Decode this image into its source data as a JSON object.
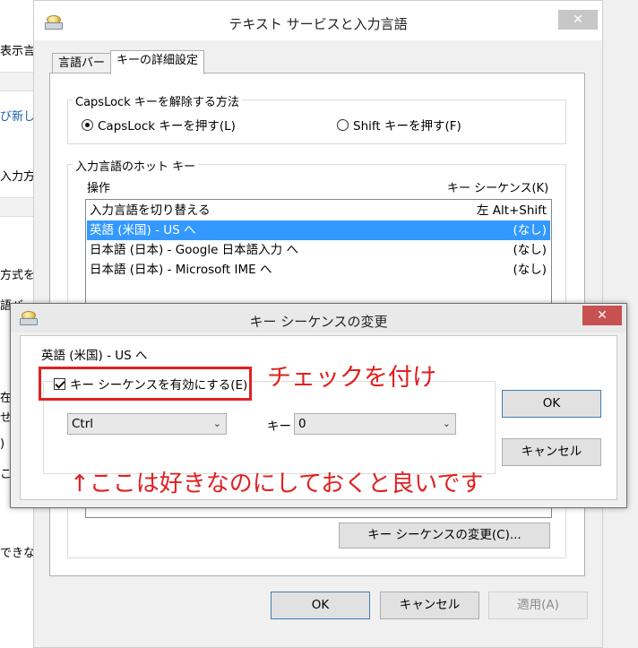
{
  "background_window": {
    "fragments": [
      "表示言",
      "び新し",
      "入力方",
      "方式を記",
      "語バ",
      "在",
      "せ",
      ")",
      "こ",
      "できな"
    ]
  },
  "main_dialog": {
    "title": "テキスト サービスと入力言語",
    "close_glyph": "✕",
    "tabs": [
      {
        "label": "言語バー",
        "active": false
      },
      {
        "label": "キーの詳細設定",
        "active": true
      }
    ],
    "capslock_group": {
      "title": "CapsLock キーを解除する方法",
      "options": [
        {
          "label": "CapsLock キーを押す(L)",
          "selected": true
        },
        {
          "label": "Shift キーを押す(F)",
          "selected": false
        }
      ]
    },
    "hotkey_group": {
      "title": "入力言語のホット キー",
      "col_action": "操作",
      "col_sequence": "キー シーケンス(K)",
      "rows": [
        {
          "action": "入力言語を切り替える",
          "sequence": "左 Alt+Shift",
          "selected": false
        },
        {
          "action": "英語 (米国) - US へ",
          "sequence": "(なし)",
          "selected": true
        },
        {
          "action": "日本語 (日本) - Google 日本語入力 へ",
          "sequence": "(なし)",
          "selected": false
        },
        {
          "action": "日本語 (日本) - Microsoft IME へ",
          "sequence": "(なし)",
          "selected": false
        }
      ],
      "change_button": "キー シーケンスの変更(C)..."
    },
    "ok_button": "OK",
    "cancel_button": "キャンセル",
    "apply_button": "適用(A)"
  },
  "sub_dialog": {
    "title": "キー シーケンスの変更",
    "close_glyph": "✕",
    "language": "英語 (米国) - US へ",
    "enable_checkbox": {
      "label": "キー シーケンスを有効にする(E)",
      "checked": true
    },
    "modifier_select": "Ctrl",
    "key_label": "キー",
    "key_select": "0",
    "ok_button": "OK",
    "cancel_button": "キャンセル"
  },
  "annotations": {
    "check_note": "チェックを付け",
    "bottom_note": "↑ここは好きなのにしておくと良いです",
    "color": "#e02020"
  }
}
